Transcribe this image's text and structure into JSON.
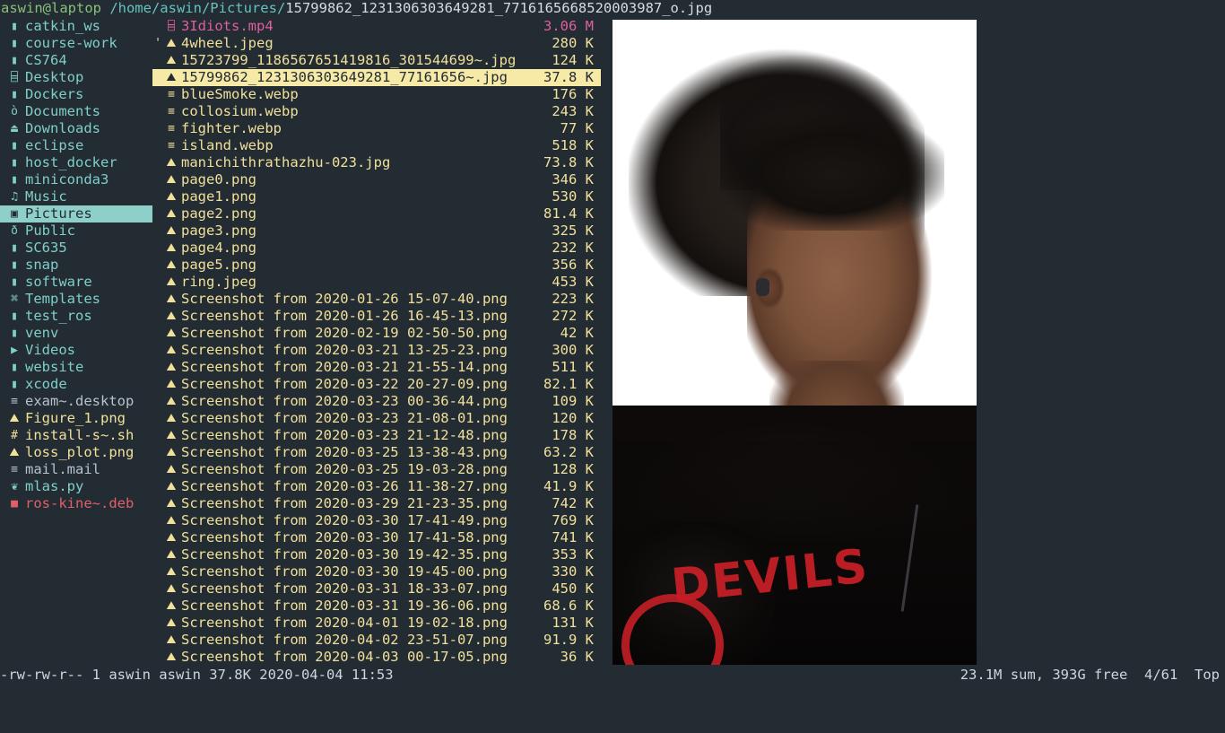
{
  "titlebar": {
    "user_host": "aswin@laptop",
    "path": " /home/aswin/Pictures/",
    "filename": "15799862_1231306303649281_7716165668520003987_o.jpg"
  },
  "sidebar": {
    "selected_index": 11,
    "items": [
      {
        "icon": "folder-icon",
        "glyph": "▮",
        "label": "catkin_ws",
        "kind": "dir"
      },
      {
        "icon": "folder-icon",
        "glyph": "▮",
        "label": "course-work",
        "kind": "dir"
      },
      {
        "icon": "folder-icon",
        "glyph": "▮",
        "label": "CS764",
        "kind": "dir"
      },
      {
        "icon": "desktop-icon",
        "glyph": "⌸",
        "label": "Desktop",
        "kind": "dir"
      },
      {
        "icon": "folder-icon",
        "glyph": "▮",
        "label": "Dockers",
        "kind": "dir"
      },
      {
        "icon": "documents-icon",
        "glyph": "ò",
        "label": "Documents",
        "kind": "dir"
      },
      {
        "icon": "downloads-icon",
        "glyph": "⏏",
        "label": "Downloads",
        "kind": "dir"
      },
      {
        "icon": "folder-icon",
        "glyph": "▮",
        "label": "eclipse",
        "kind": "dir"
      },
      {
        "icon": "folder-icon",
        "glyph": "▮",
        "label": "host_docker",
        "kind": "dir"
      },
      {
        "icon": "folder-icon",
        "glyph": "▮",
        "label": "miniconda3",
        "kind": "dir"
      },
      {
        "icon": "music-icon",
        "glyph": "♫",
        "label": "Music",
        "kind": "dir"
      },
      {
        "icon": "pictures-icon",
        "glyph": "▣",
        "label": "Pictures",
        "kind": "dir"
      },
      {
        "icon": "public-icon",
        "glyph": "ð",
        "label": "Public",
        "kind": "dir"
      },
      {
        "icon": "folder-icon",
        "glyph": "▮",
        "label": "SC635",
        "kind": "dir"
      },
      {
        "icon": "folder-icon",
        "glyph": "▮",
        "label": "snap",
        "kind": "dir"
      },
      {
        "icon": "folder-icon",
        "glyph": "▮",
        "label": "software",
        "kind": "dir"
      },
      {
        "icon": "templates-icon",
        "glyph": "⌘",
        "label": "Templates",
        "kind": "dir"
      },
      {
        "icon": "folder-icon",
        "glyph": "▮",
        "label": "test_ros",
        "kind": "dir"
      },
      {
        "icon": "folder-icon",
        "glyph": "▮",
        "label": "venv",
        "kind": "dir"
      },
      {
        "icon": "video-icon",
        "glyph": "▶",
        "label": "Videos",
        "kind": "dir"
      },
      {
        "icon": "folder-icon",
        "glyph": "▮",
        "label": "website",
        "kind": "dir"
      },
      {
        "icon": "folder-icon",
        "glyph": "▮",
        "label": "xcode",
        "kind": "dir"
      },
      {
        "icon": "text-file-icon",
        "glyph": "≡",
        "label": "exam~.desktop",
        "kind": "file-white"
      },
      {
        "icon": "image-file-icon",
        "glyph": "⛰",
        "label": "Figure_1.png",
        "kind": "file-yellow"
      },
      {
        "icon": "shell-script-icon",
        "glyph": "#",
        "label": "install-s~.sh",
        "kind": "file-yellow"
      },
      {
        "icon": "image-file-icon",
        "glyph": "⛰",
        "label": "loss_plot.png",
        "kind": "file-yellow"
      },
      {
        "icon": "text-file-icon",
        "glyph": "≡",
        "label": "mail.mail",
        "kind": "file-white"
      },
      {
        "icon": "python-file-icon",
        "glyph": "❦",
        "label": "mlas.py",
        "kind": "file-teal"
      },
      {
        "icon": "package-file-icon",
        "glyph": "■",
        "label": "ros-kine~.deb",
        "kind": "file-red"
      }
    ]
  },
  "filelist": {
    "selected_index": 3,
    "columns": [
      "name",
      "size"
    ],
    "rows": [
      {
        "icon": "video-file-icon",
        "glyph": "⌸",
        "mark": "",
        "name": "3Idiots.mp4",
        "size": "3.06 M",
        "kind": "file-pink"
      },
      {
        "icon": "image-file-icon",
        "glyph": "⛰",
        "mark": "'",
        "name": "4wheel.jpeg",
        "size": "280 K",
        "kind": "file-yellow"
      },
      {
        "icon": "image-file-icon",
        "glyph": "⛰",
        "mark": "",
        "name": "15723799_1186567651419816_301544699~.jpg",
        "size": "124 K",
        "kind": "file-yellow"
      },
      {
        "icon": "image-file-icon",
        "glyph": "⛰",
        "mark": "",
        "name": "15799862_1231306303649281_77161656~.jpg",
        "size": "37.8 K",
        "kind": "file-yellow"
      },
      {
        "icon": "text-file-icon",
        "glyph": "≡",
        "mark": "",
        "name": "blueSmoke.webp",
        "size": "176 K",
        "kind": "file-yellow"
      },
      {
        "icon": "text-file-icon",
        "glyph": "≡",
        "mark": "",
        "name": "collosium.webp",
        "size": "243 K",
        "kind": "file-yellow"
      },
      {
        "icon": "text-file-icon",
        "glyph": "≡",
        "mark": "",
        "name": "fighter.webp",
        "size": "77 K",
        "kind": "file-yellow"
      },
      {
        "icon": "text-file-icon",
        "glyph": "≡",
        "mark": "",
        "name": "island.webp",
        "size": "518 K",
        "kind": "file-yellow"
      },
      {
        "icon": "image-file-icon",
        "glyph": "⛰",
        "mark": "",
        "name": "manichithrathazhu-023.jpg",
        "size": "73.8 K",
        "kind": "file-yellow"
      },
      {
        "icon": "image-file-icon",
        "glyph": "⛰",
        "mark": "",
        "name": "page0.png",
        "size": "346 K",
        "kind": "file-yellow"
      },
      {
        "icon": "image-file-icon",
        "glyph": "⛰",
        "mark": "",
        "name": "page1.png",
        "size": "530 K",
        "kind": "file-yellow"
      },
      {
        "icon": "image-file-icon",
        "glyph": "⛰",
        "mark": "",
        "name": "page2.png",
        "size": "81.4 K",
        "kind": "file-yellow"
      },
      {
        "icon": "image-file-icon",
        "glyph": "⛰",
        "mark": "",
        "name": "page3.png",
        "size": "325 K",
        "kind": "file-yellow"
      },
      {
        "icon": "image-file-icon",
        "glyph": "⛰",
        "mark": "",
        "name": "page4.png",
        "size": "232 K",
        "kind": "file-yellow"
      },
      {
        "icon": "image-file-icon",
        "glyph": "⛰",
        "mark": "",
        "name": "page5.png",
        "size": "356 K",
        "kind": "file-yellow"
      },
      {
        "icon": "image-file-icon",
        "glyph": "⛰",
        "mark": "",
        "name": "ring.jpeg",
        "size": "453 K",
        "kind": "file-yellow"
      },
      {
        "icon": "image-file-icon",
        "glyph": "⛰",
        "mark": "",
        "name": "Screenshot from 2020-01-26 15-07-40.png",
        "size": "223 K",
        "kind": "file-yellow"
      },
      {
        "icon": "image-file-icon",
        "glyph": "⛰",
        "mark": "",
        "name": "Screenshot from 2020-01-26 16-45-13.png",
        "size": "272 K",
        "kind": "file-yellow"
      },
      {
        "icon": "image-file-icon",
        "glyph": "⛰",
        "mark": "",
        "name": "Screenshot from 2020-02-19 02-50-50.png",
        "size": "42 K",
        "kind": "file-yellow"
      },
      {
        "icon": "image-file-icon",
        "glyph": "⛰",
        "mark": "",
        "name": "Screenshot from 2020-03-21 13-25-23.png",
        "size": "300 K",
        "kind": "file-yellow"
      },
      {
        "icon": "image-file-icon",
        "glyph": "⛰",
        "mark": "",
        "name": "Screenshot from 2020-03-21 21-55-14.png",
        "size": "511 K",
        "kind": "file-yellow"
      },
      {
        "icon": "image-file-icon",
        "glyph": "⛰",
        "mark": "",
        "name": "Screenshot from 2020-03-22 20-27-09.png",
        "size": "82.1 K",
        "kind": "file-yellow"
      },
      {
        "icon": "image-file-icon",
        "glyph": "⛰",
        "mark": "",
        "name": "Screenshot from 2020-03-23 00-36-44.png",
        "size": "109 K",
        "kind": "file-yellow"
      },
      {
        "icon": "image-file-icon",
        "glyph": "⛰",
        "mark": "",
        "name": "Screenshot from 2020-03-23 21-08-01.png",
        "size": "120 K",
        "kind": "file-yellow"
      },
      {
        "icon": "image-file-icon",
        "glyph": "⛰",
        "mark": "",
        "name": "Screenshot from 2020-03-23 21-12-48.png",
        "size": "178 K",
        "kind": "file-yellow"
      },
      {
        "icon": "image-file-icon",
        "glyph": "⛰",
        "mark": "",
        "name": "Screenshot from 2020-03-25 13-38-43.png",
        "size": "63.2 K",
        "kind": "file-yellow"
      },
      {
        "icon": "image-file-icon",
        "glyph": "⛰",
        "mark": "",
        "name": "Screenshot from 2020-03-25 19-03-28.png",
        "size": "128 K",
        "kind": "file-yellow"
      },
      {
        "icon": "image-file-icon",
        "glyph": "⛰",
        "mark": "",
        "name": "Screenshot from 2020-03-26 11-38-27.png",
        "size": "41.9 K",
        "kind": "file-yellow"
      },
      {
        "icon": "image-file-icon",
        "glyph": "⛰",
        "mark": "",
        "name": "Screenshot from 2020-03-29 21-23-35.png",
        "size": "742 K",
        "kind": "file-yellow"
      },
      {
        "icon": "image-file-icon",
        "glyph": "⛰",
        "mark": "",
        "name": "Screenshot from 2020-03-30 17-41-49.png",
        "size": "769 K",
        "kind": "file-yellow"
      },
      {
        "icon": "image-file-icon",
        "glyph": "⛰",
        "mark": "",
        "name": "Screenshot from 2020-03-30 17-41-58.png",
        "size": "741 K",
        "kind": "file-yellow"
      },
      {
        "icon": "image-file-icon",
        "glyph": "⛰",
        "mark": "",
        "name": "Screenshot from 2020-03-30 19-42-35.png",
        "size": "353 K",
        "kind": "file-yellow"
      },
      {
        "icon": "image-file-icon",
        "glyph": "⛰",
        "mark": "",
        "name": "Screenshot from 2020-03-30 19-45-00.png",
        "size": "330 K",
        "kind": "file-yellow"
      },
      {
        "icon": "image-file-icon",
        "glyph": "⛰",
        "mark": "",
        "name": "Screenshot from 2020-03-31 18-33-07.png",
        "size": "450 K",
        "kind": "file-yellow"
      },
      {
        "icon": "image-file-icon",
        "glyph": "⛰",
        "mark": "",
        "name": "Screenshot from 2020-03-31 19-36-06.png",
        "size": "68.6 K",
        "kind": "file-yellow"
      },
      {
        "icon": "image-file-icon",
        "glyph": "⛰",
        "mark": "",
        "name": "Screenshot from 2020-04-01 19-02-18.png",
        "size": "131 K",
        "kind": "file-yellow"
      },
      {
        "icon": "image-file-icon",
        "glyph": "⛰",
        "mark": "",
        "name": "Screenshot from 2020-04-02 23-51-07.png",
        "size": "91.9 K",
        "kind": "file-yellow"
      },
      {
        "icon": "image-file-icon",
        "glyph": "⛰",
        "mark": "",
        "name": "Screenshot from 2020-04-03 00-17-05.png",
        "size": "36 K",
        "kind": "file-yellow"
      }
    ]
  },
  "preview": {
    "alt": "portrait photo of a young man wearing earphones and a black t-shirt with red print",
    "shirt_text_line1": "DEVILS"
  },
  "statusbar": {
    "left": "-rw-rw-r-- 1 aswin aswin 37.8K 2020-04-04 11:53",
    "right": "23.1M sum, 393G free  4/61  Top"
  },
  "colors": {
    "background": "#232b33",
    "dir": "#7fcfc9",
    "file_yellow": "#f0e09a",
    "file_white": "#b8c2cc",
    "file_red": "#e0606a",
    "file_pink": "#e05f9e",
    "selection_sidebar": "#8fcfc9",
    "selection_filelist": "#f7e9a6",
    "user_green": "#88c07a",
    "path_cyan": "#66c2bd"
  }
}
